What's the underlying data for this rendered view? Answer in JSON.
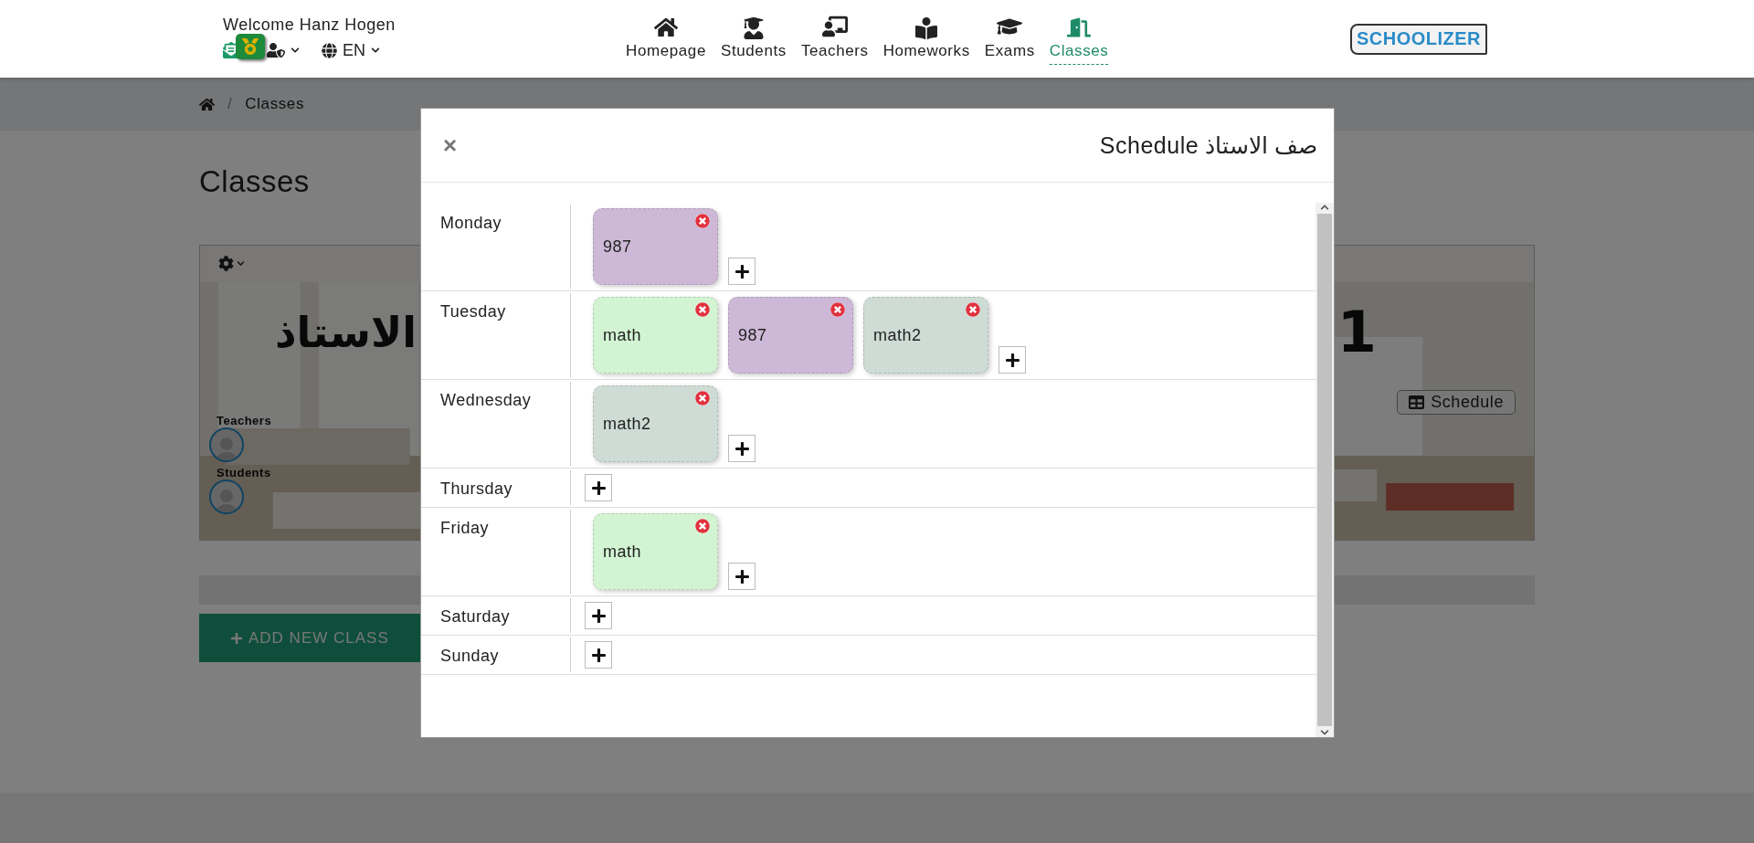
{
  "header": {
    "welcome": "Welcome Hanz Hogen",
    "language": "EN",
    "logo": "SCHOOLIZER",
    "nav": [
      {
        "label": "Homepage",
        "kind": "home",
        "selected": false
      },
      {
        "label": "Students",
        "kind": "student",
        "selected": false
      },
      {
        "label": "Teachers",
        "kind": "teacher",
        "selected": false
      },
      {
        "label": "Homeworks",
        "kind": "reader",
        "selected": false
      },
      {
        "label": "Exams",
        "kind": "cap",
        "selected": false
      },
      {
        "label": "Classes",
        "kind": "door",
        "selected": true
      }
    ]
  },
  "breadcrumb": {
    "separator": "/",
    "items": [
      "Classes"
    ]
  },
  "page_title": "Classes",
  "class_card": {
    "title_fragments": [
      "الاستاذ",
      "1"
    ],
    "teachers_label": "Teachers",
    "students_label": "Students",
    "schedule_button": "Schedule"
  },
  "add_button": "ADD NEW CLASS",
  "modal": {
    "title": "صف الاستاذ Schedule",
    "close": "×",
    "days": [
      {
        "name": "Monday",
        "lessons": [
          {
            "name": "987",
            "color": "#cdb9d7"
          }
        ]
      },
      {
        "name": "Tuesday",
        "lessons": [
          {
            "name": "math",
            "color": "#d3f4d3"
          },
          {
            "name": "987",
            "color": "#cdb9d7"
          },
          {
            "name": "math2",
            "color": "#cedcd5"
          }
        ]
      },
      {
        "name": "Wednesday",
        "lessons": [
          {
            "name": "math2",
            "color": "#cedcd5"
          }
        ]
      },
      {
        "name": "Thursday"
      },
      {
        "name": "Friday",
        "lessons": [
          {
            "name": "math",
            "color": "#d3f4d3"
          }
        ]
      },
      {
        "name": "Saturday"
      },
      {
        "name": "Sunday"
      }
    ]
  }
}
